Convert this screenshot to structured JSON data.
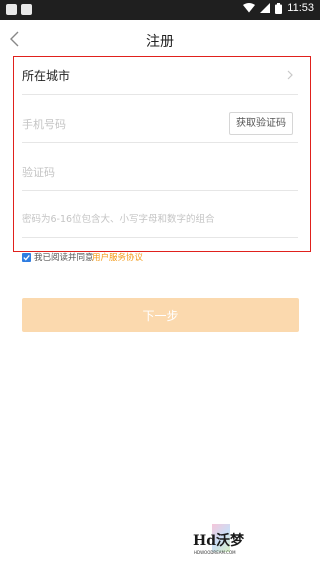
{
  "status_bar": {
    "time": "11:53"
  },
  "nav": {
    "title": "注册",
    "back_icon": "chevron-left-icon"
  },
  "form": {
    "city_label": "所在城市",
    "phone_placeholder": "手机号码",
    "get_code_label": "获取验证码",
    "code_placeholder": "验证码",
    "password_placeholder": "密码为6-16位包含大、小写字母和数字的组合"
  },
  "agreement": {
    "checked": true,
    "text": "我已阅读并同意",
    "link": "用户服务协议"
  },
  "next_button": {
    "label": "下一步"
  },
  "watermark": {
    "text": "Hd沃梦",
    "sub": "HDWOODREAM.COM"
  },
  "colors": {
    "highlight_border": "#e0211d",
    "accent": "#f39a18",
    "button_bg": "#fbd9ae",
    "checkbox": "#2f7de1"
  }
}
